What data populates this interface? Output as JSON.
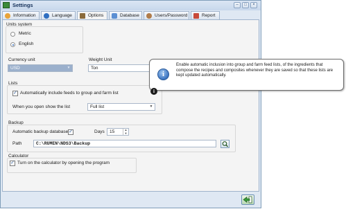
{
  "window": {
    "title": "Settings"
  },
  "tabs": [
    {
      "label": "Information",
      "icon": "information-icon",
      "color": "#e8a33a"
    },
    {
      "label": "Language",
      "icon": "globe-icon",
      "color": "#2f6fc1"
    },
    {
      "label": "Options",
      "icon": "options-icon",
      "color": "#8a6a3a",
      "active": true
    },
    {
      "label": "Database",
      "icon": "database-icon",
      "color": "#5b8fd3"
    },
    {
      "label": "Users/Password",
      "icon": "users-icon",
      "color": "#b07c4a"
    },
    {
      "label": "Report",
      "icon": "report-icon",
      "color": "#c84a3a"
    }
  ],
  "units": {
    "heading": "Units system",
    "options": [
      {
        "label": "Metric",
        "selected": false
      },
      {
        "label": "English",
        "selected": true
      }
    ]
  },
  "currency": {
    "label": "Currency unit",
    "value": "USD"
  },
  "weight": {
    "label": "Weight Unit",
    "value": "Ton"
  },
  "lists": {
    "heading": "Lists",
    "auto_include_label": "Automatically include feeds to group and farm list",
    "auto_include_checked": true,
    "open_show_label": "When you open show the list",
    "open_show_value": "Full list"
  },
  "backup": {
    "heading": "Backup",
    "auto_label": "Automatic backup database",
    "auto_checked": true,
    "days_label": "Days",
    "days_value": "15",
    "path_label": "Path",
    "path_value": "C:\\RUMEN\\NDS3\\Backup"
  },
  "calculator": {
    "heading": "Calculator",
    "turn_on_label": "Turn on the calculator by opening the program",
    "turn_on_checked": true
  },
  "tooltip": {
    "text": "Enable automatic inclusion into group and farm feed lists, of the ingredients that compose the recipes and composites whenever they are saved so that these lists are kept updated automatically."
  },
  "colors": {
    "accent": "#2e6bbf",
    "panel": "#f4f4f4",
    "frame": "#dfe8f3"
  }
}
